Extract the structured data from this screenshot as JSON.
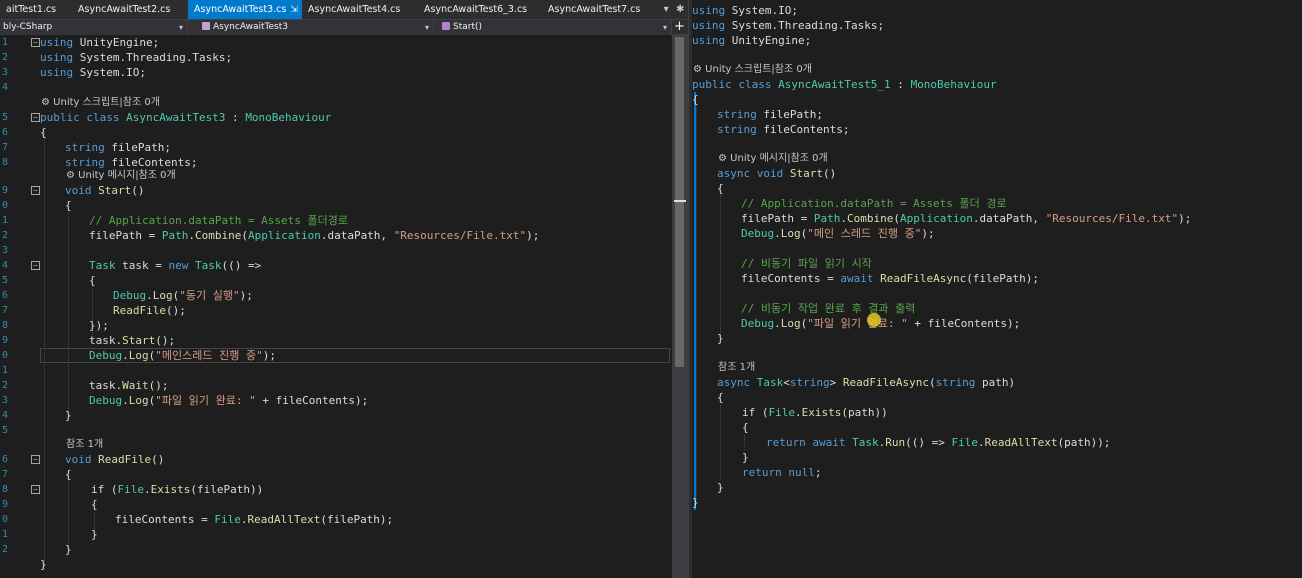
{
  "tabs": [
    {
      "label": "aitTest1.cs",
      "active": false
    },
    {
      "label": "AsyncAwaitTest2.cs",
      "active": false
    },
    {
      "label": "AsyncAwaitTest3.cs",
      "active": true
    },
    {
      "label": "AsyncAwaitTest4.cs",
      "active": false
    },
    {
      "label": "AsyncAwaitTest6_3.cs",
      "active": false
    },
    {
      "label": "AsyncAwaitTest7.cs",
      "active": false
    }
  ],
  "nav": {
    "project": "bly-CSharp",
    "class": "AsyncAwaitTest3",
    "member": "Start()"
  },
  "left_code": {
    "line_numbers": [
      "1",
      "2",
      "3",
      "4",
      "5",
      "6",
      "7",
      "8",
      "9",
      "0",
      "1",
      "2",
      "3",
      "4",
      "5",
      "6",
      "7",
      "8",
      "9",
      "0",
      "1",
      "2",
      "3",
      "4",
      "5",
      "6",
      "7",
      "8",
      "9",
      "0",
      "1",
      "2"
    ],
    "l1": {
      "a": "using",
      "b": " UnityEngine;"
    },
    "l2": {
      "a": "using",
      "b": " System.Threading.Tasks;"
    },
    "l3": {
      "a": "using",
      "b": " System.IO;"
    },
    "ref1": "Unity 스크립트|참조 0개",
    "l5": {
      "a": "public class ",
      "b": "AsyncAwaitTest3",
      "c": " : ",
      "d": "MonoBehaviour"
    },
    "l6": "{",
    "l7": {
      "a": "string",
      "b": " filePath;"
    },
    "l8": {
      "a": "string",
      "b": " fileContents;"
    },
    "ref2": "Unity 메시지|참조 0개",
    "l9": {
      "a": "void ",
      "b": "Start",
      "c": "()"
    },
    "l10": "{",
    "l11": "// Application.dataPath = Assets 폴더경로",
    "l12": {
      "a": "filePath = ",
      "b": "Path",
      "c": ".",
      "d": "Combine",
      "e": "(",
      "f": "Application",
      "g": ".dataPath, ",
      "h": "\"Resources/File.txt\"",
      "i": ");"
    },
    "l14": {
      "a": "Task",
      "b": " task = ",
      "c": "new ",
      "d": "Task",
      "e": "(() =>"
    },
    "l15": "{",
    "l16": {
      "a": "Debug",
      "b": ".",
      "c": "Log",
      "d": "(",
      "e": "\"동기 실행\"",
      "f": ");"
    },
    "l17": {
      "a": "ReadFile",
      "b": "();"
    },
    "l18": "});",
    "l19": {
      "a": "task.",
      "b": "Start",
      "c": "();"
    },
    "l20": {
      "a": "Debug",
      "b": ".",
      "c": "Log",
      "d": "(",
      "e": "\"메인스레드 진행 중\"",
      "f": ");"
    },
    "l22": {
      "a": "task.",
      "b": "Wait",
      "c": "();"
    },
    "l23": {
      "a": "Debug",
      "b": ".",
      "c": "Log",
      "d": "(",
      "e": "\"파일 읽기 완료: \"",
      "f": " + fileContents);"
    },
    "l24": "}",
    "ref3": "참조 1개",
    "l26": {
      "a": "void ",
      "b": "ReadFile",
      "c": "()"
    },
    "l27": "{",
    "l28": {
      "a": "if (",
      "b": "File",
      "c": ".",
      "d": "Exists",
      "e": "(filePath))"
    },
    "l29": "{",
    "l30": {
      "a": "fileContents = ",
      "b": "File",
      "c": ".",
      "d": "ReadAllText",
      "e": "(filePath);"
    },
    "l31": "}",
    "l32": "}",
    "l33": "}"
  },
  "right_code": {
    "r1": {
      "a": "using",
      "b": " System.IO;"
    },
    "r2": {
      "a": "using",
      "b": " System.Threading.Tasks;"
    },
    "r3": {
      "a": "using",
      "b": " UnityEngine;"
    },
    "ref1": "Unity 스크립트|참조 0개",
    "r5": {
      "a": "public class ",
      "b": "AsyncAwaitTest5_1",
      "c": " : ",
      "d": "MonoBehaviour"
    },
    "r6": "{",
    "r7": {
      "a": "string",
      "b": " filePath;"
    },
    "r8": {
      "a": "string",
      "b": " fileContents;"
    },
    "ref2": "Unity 메시지|참조 0개",
    "r10": {
      "a": "async void ",
      "b": "Start",
      "c": "()"
    },
    "r11": "{",
    "r12": "// Application.dataPath = Assets 폴더 경로",
    "r13": {
      "a": "filePath = ",
      "b": "Path",
      "c": ".",
      "d": "Combine",
      "e": "(",
      "f": "Application",
      "g": ".dataPath, ",
      "h": "\"Resources/File.txt\"",
      "i": ");"
    },
    "r14": {
      "a": "Debug",
      "b": ".",
      "c": "Log",
      "d": "(",
      "e": "\"메인 스레드 진행 중\"",
      "f": ");"
    },
    "r16": "// 비동기 파일 읽기 시작",
    "r17": {
      "a": "fileContents = ",
      "b": "await ",
      "c": "ReadFileAsync",
      "d": "(filePath);"
    },
    "r19": "// 비동기 작업 완료 후 결과 출력",
    "r20": {
      "a": "Debug",
      "b": ".",
      "c": "Log",
      "d": "(",
      "e": "\"파일 읽기 완료: \"",
      "f": " + fileContents);"
    },
    "r21": "}",
    "ref3": "참조 1개",
    "r23": {
      "a": "async ",
      "b": "Task",
      "c": "<",
      "d": "string",
      "e": "> ",
      "f": "ReadFileAsync",
      "g": "(",
      "h": "string",
      "i": " path)"
    },
    "r24": "{",
    "r25": {
      "a": "if (",
      "b": "File",
      "c": ".",
      "d": "Exists",
      "e": "(path))"
    },
    "r26": "{",
    "r27": {
      "a": "return ",
      "b": "await ",
      "c": "Task",
      "d": ".",
      "e": "Run",
      "f": "(() => ",
      "g": "File",
      "h": ".",
      "i": "ReadAllText",
      "j": "(path));"
    },
    "r28": "}",
    "r29": {
      "a": "return ",
      "b": "null",
      "c": ";"
    },
    "r30": "}",
    "r31": "}"
  },
  "colors": {
    "keyword": "#569cd6",
    "type": "#4ec9b0",
    "string": "#d69d85",
    "comment": "#57a64a",
    "method": "#dcdcaa",
    "active_tab": "#007acc",
    "background": "#1e1e1e"
  },
  "icons": {
    "tab_close": "close-icon",
    "tab_pin": "pin-icon",
    "dropdown": "chevron-down-icon",
    "add": "plus-icon",
    "settings": "gear-icon"
  }
}
